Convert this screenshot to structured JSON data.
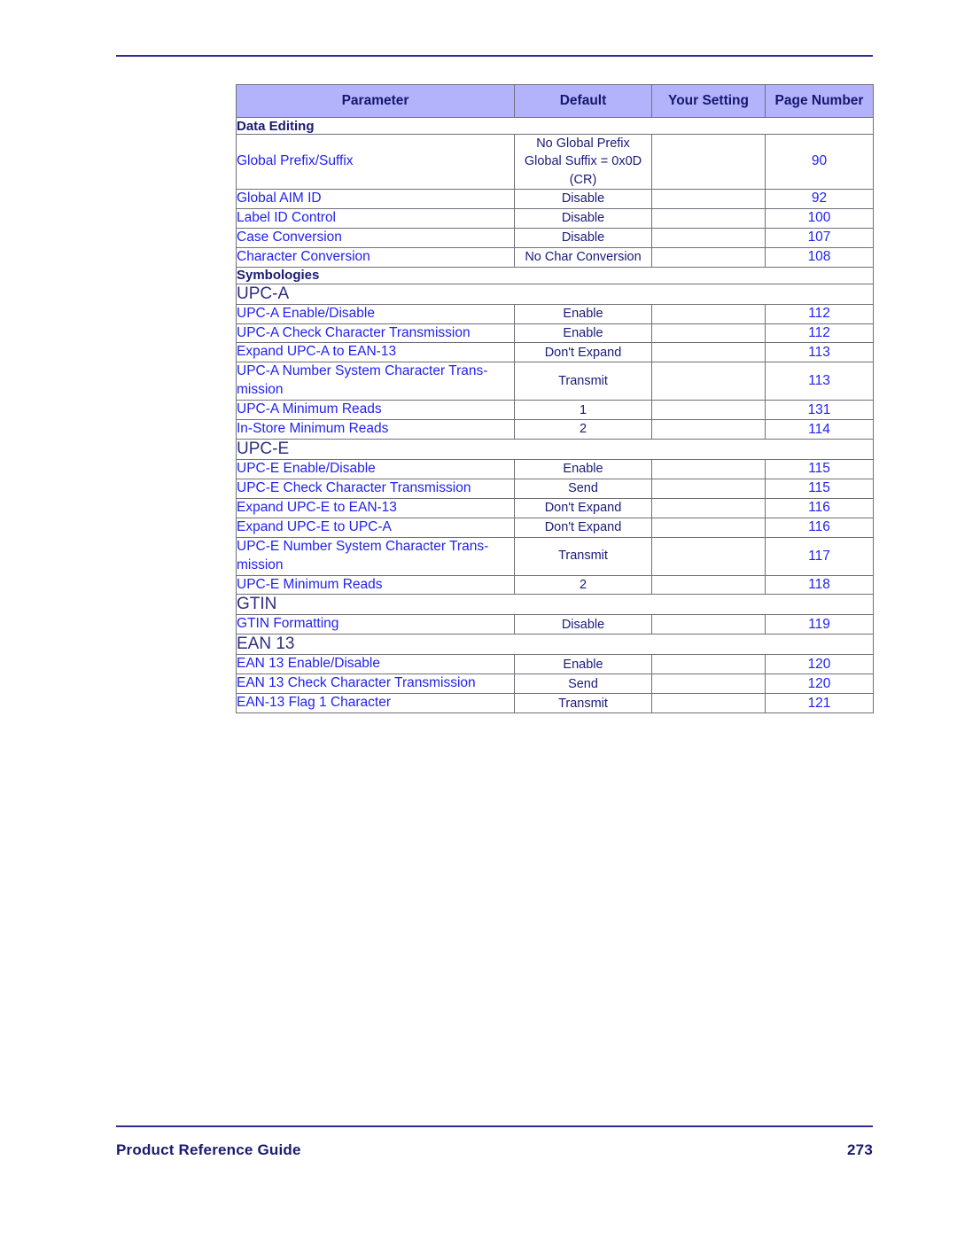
{
  "document": {
    "footer_title": "Product Reference Guide",
    "page_number": "273"
  },
  "table": {
    "columns": [
      "Parameter",
      "Default",
      "Your Setting",
      "Page Number"
    ],
    "rows": [
      {
        "kind": "section",
        "label": "Data Editing"
      },
      {
        "kind": "param",
        "parameter": "Global Prefix/Suffix",
        "default": "No Global Prefix\nGlobal Suffix = 0x0D\n(CR)",
        "your_setting": "",
        "page": "90"
      },
      {
        "kind": "param",
        "parameter": "Global AIM ID",
        "default": "Disable",
        "your_setting": "",
        "page": "92"
      },
      {
        "kind": "param",
        "parameter": "Label ID Control",
        "default": "Disable",
        "your_setting": "",
        "page": "100"
      },
      {
        "kind": "param",
        "parameter": "Case Conversion",
        "default": "Disable",
        "your_setting": "",
        "page": "107"
      },
      {
        "kind": "param",
        "parameter": "Character Conversion",
        "default": "No Char Conversion",
        "your_setting": "",
        "page": "108"
      },
      {
        "kind": "section",
        "label": "Symbologies"
      },
      {
        "kind": "symbology",
        "label": "UPC-A"
      },
      {
        "kind": "param",
        "parameter": "UPC-A Enable/Disable",
        "default": "Enable",
        "your_setting": "",
        "page": "112"
      },
      {
        "kind": "param",
        "parameter": "UPC-A Check Character Transmission",
        "default": "Enable",
        "your_setting": "",
        "page": "112"
      },
      {
        "kind": "param",
        "parameter": "Expand UPC-A to EAN-13",
        "default": "Don't Expand",
        "your_setting": "",
        "page": "113"
      },
      {
        "kind": "param",
        "parameter": "UPC-A Number System Character Trans-mission",
        "default": "Transmit",
        "your_setting": "",
        "page": "113"
      },
      {
        "kind": "param",
        "parameter": "UPC-A Minimum Reads",
        "default": "1",
        "your_setting": "",
        "page": "131"
      },
      {
        "kind": "param",
        "parameter": "In-Store Minimum Reads",
        "default": "2",
        "your_setting": "",
        "page": "114"
      },
      {
        "kind": "symbology",
        "label": "UPC-E"
      },
      {
        "kind": "param",
        "parameter": "UPC-E Enable/Disable",
        "default": "Enable",
        "your_setting": "",
        "page": "115"
      },
      {
        "kind": "param",
        "parameter": "UPC-E Check Character Transmission",
        "default": "Send",
        "your_setting": "",
        "page": "115"
      },
      {
        "kind": "param",
        "parameter": "Expand UPC-E to EAN-13",
        "default": "Don't Expand",
        "your_setting": "",
        "page": "116"
      },
      {
        "kind": "param",
        "parameter": "Expand UPC-E to UPC-A",
        "default": "Don't Expand",
        "your_setting": "",
        "page": "116"
      },
      {
        "kind": "param",
        "parameter": "UPC-E Number System Character Trans-mission",
        "default": "Transmit",
        "your_setting": "",
        "page": "117"
      },
      {
        "kind": "param",
        "parameter": "UPC-E Minimum Reads",
        "default": "2",
        "your_setting": "",
        "page": "118"
      },
      {
        "kind": "symbology",
        "label": "GTIN"
      },
      {
        "kind": "param",
        "parameter": "GTIN Formatting",
        "default": "Disable",
        "your_setting": "",
        "page": "119"
      },
      {
        "kind": "symbology",
        "label": "EAN 13"
      },
      {
        "kind": "param",
        "parameter": "EAN 13 Enable/Disable",
        "default": "Enable",
        "your_setting": "",
        "page": "120"
      },
      {
        "kind": "param",
        "parameter": "EAN 13 Check Character Transmission",
        "default": "Send",
        "your_setting": "",
        "page": "120"
      },
      {
        "kind": "param",
        "parameter": "EAN-13 Flag 1 Character",
        "default": "Transmit",
        "your_setting": "",
        "page": "121"
      }
    ]
  }
}
